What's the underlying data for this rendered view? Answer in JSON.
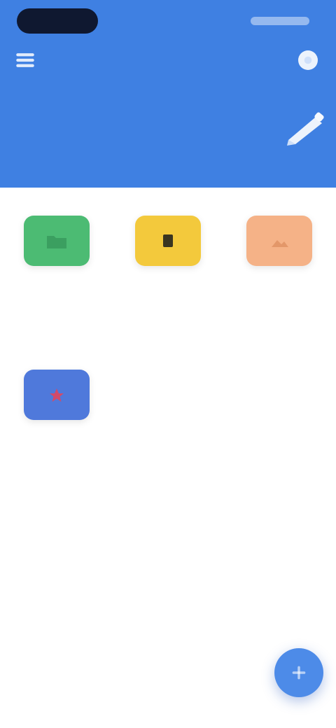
{
  "header": {
    "title": "",
    "menu_icon": "menu-icon",
    "settings_icon": "settings-icon",
    "edit_icon": "edit-pen-icon",
    "color": "#3f80e2"
  },
  "categories": [
    {
      "name": "",
      "count": "",
      "color": "#4cbb73",
      "icon": "folder-icon"
    },
    {
      "name": "",
      "count": "",
      "color": "#f3c93c",
      "icon": "document-icon"
    },
    {
      "name": "",
      "count": "",
      "color": "#f5b287",
      "icon": "image-icon"
    },
    {
      "name": "",
      "count": "",
      "color": "#4f79db",
      "icon": "star-icon"
    }
  ],
  "fab": {
    "icon": "add-icon",
    "color": "#4d8be8"
  }
}
